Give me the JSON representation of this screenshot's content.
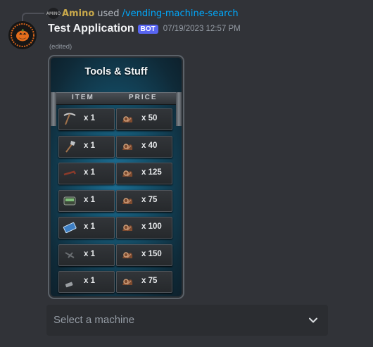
{
  "reply": {
    "avatar_label": "AMINO",
    "user": "Amino",
    "used": "used",
    "command": "/vending-machine-search"
  },
  "message": {
    "username": "Test Application",
    "badge": "BOT",
    "timestamp": "07/19/2023 12:57 PM",
    "edited": "(edited)"
  },
  "card": {
    "title": "Tools & Stuff",
    "col_item": "ITEM",
    "col_price": "PRICE",
    "rows": [
      {
        "item_icon": "pickaxe-icon",
        "item_qty": "x 1",
        "price_icon": "scrap-icon",
        "price": "x 50"
      },
      {
        "item_icon": "shovel-icon",
        "item_qty": "x 1",
        "price_icon": "scrap-icon",
        "price": "x 40"
      },
      {
        "item_icon": "crowbar-icon",
        "item_qty": "x 1",
        "price_icon": "scrap-icon",
        "price": "x 125"
      },
      {
        "item_icon": "pager-icon",
        "item_qty": "x 1",
        "price_icon": "scrap-icon",
        "price": "x 75"
      },
      {
        "item_icon": "blueprint-card-icon",
        "item_qty": "x 1",
        "price_icon": "scrap-icon",
        "price": "x 100"
      },
      {
        "item_icon": "small-tool-icon",
        "item_qty": "x 1",
        "price_icon": "scrap-icon",
        "price": "x 150"
      },
      {
        "item_icon": "flashlight-icon",
        "item_qty": "x 1",
        "price_icon": "scrap-icon",
        "price": "x 75"
      }
    ]
  },
  "select": {
    "placeholder": "Select a machine",
    "icon": "chevron-down-icon"
  },
  "colors": {
    "background": "#313338",
    "link": "#00a8fc",
    "badge": "#5865f2",
    "reply_user": "#c8a84b"
  }
}
